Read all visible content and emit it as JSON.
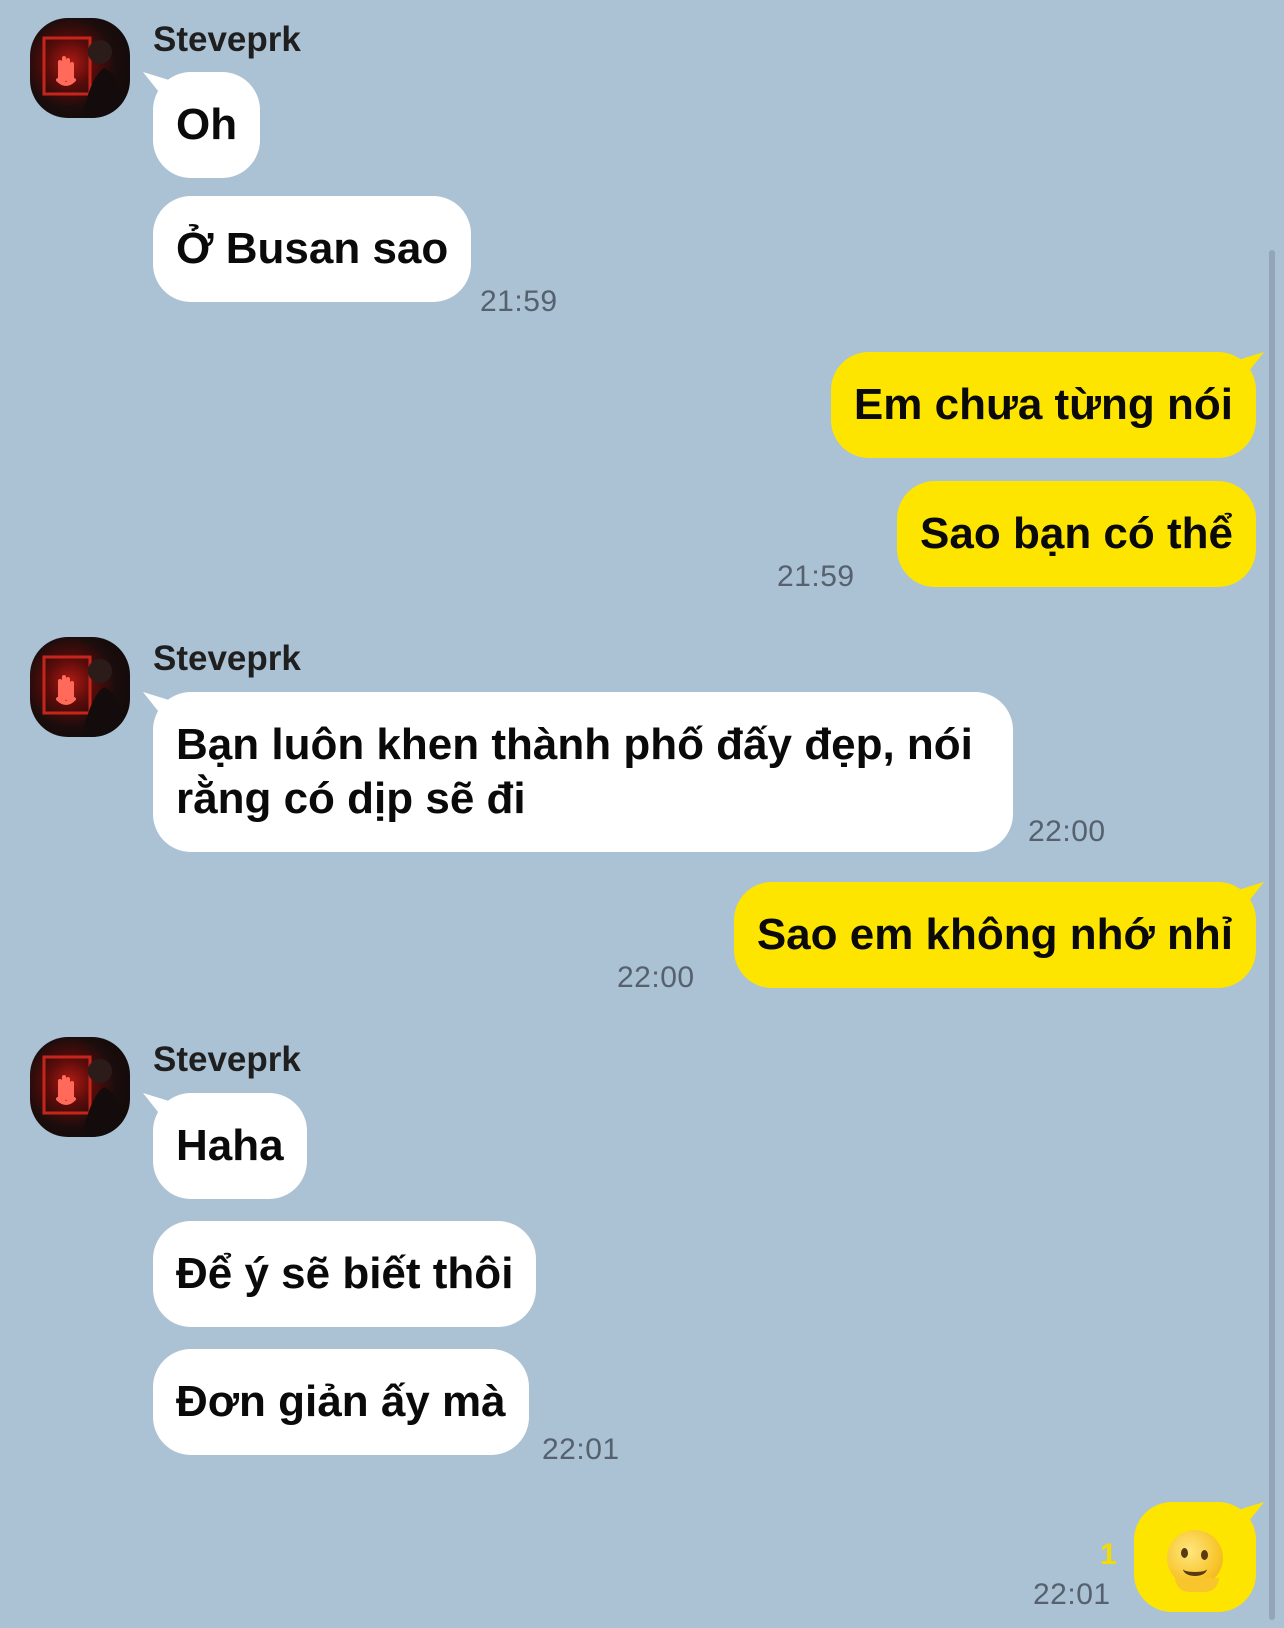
{
  "messages": {
    "group1": {
      "sender": "Steveprk",
      "bubbles": [
        "Oh",
        "Ở Busan sao"
      ],
      "time": "21:59"
    },
    "out1": {
      "bubbles": [
        "Em chưa từng nói",
        "Sao bạn có thể"
      ],
      "time": "21:59"
    },
    "group2": {
      "sender": "Steveprk",
      "line1": "Bạn luôn khen thành phố đấy đẹp, nói",
      "line2": "rằng có dịp sẽ đi",
      "time": "22:00"
    },
    "out2": {
      "bubbles": [
        "Sao em không nhớ nhỉ"
      ],
      "time": "22:00"
    },
    "group3": {
      "sender": "Steveprk",
      "bubbles": [
        "Haha",
        "Để ý sẽ biết thôi",
        "Đơn giản ấy mà"
      ],
      "time": "22:01"
    },
    "out3": {
      "emoji": "melting-face",
      "unread": "1",
      "time": "22:01"
    }
  },
  "colors": {
    "background": "#abc1d4",
    "incoming_bubble": "#ffffff",
    "outgoing_bubble": "#fee500"
  }
}
